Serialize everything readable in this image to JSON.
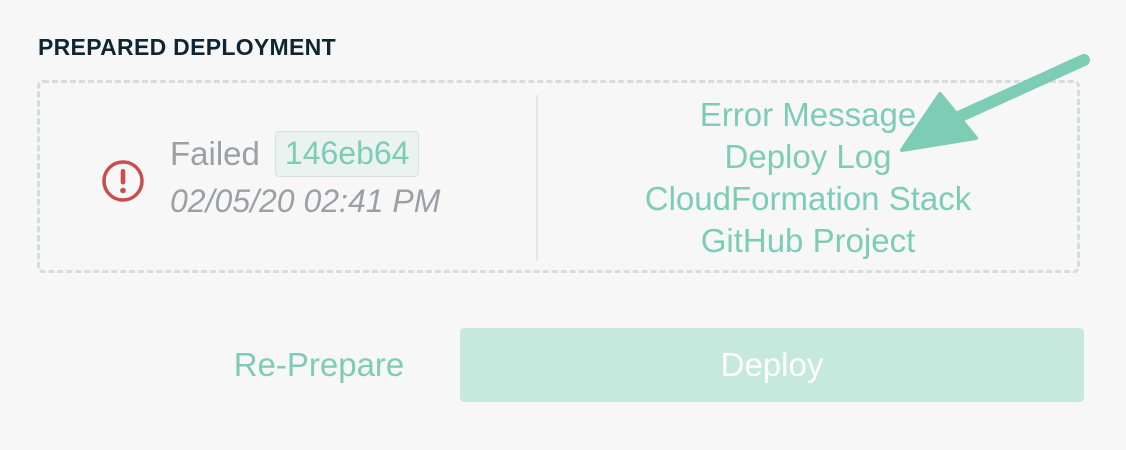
{
  "section": {
    "title": "PREPARED DEPLOYMENT"
  },
  "deployment": {
    "status": "Failed",
    "commit": "146eb64",
    "timestamp": "02/05/20 02:41 PM",
    "status_icon": "error-exclamation-icon"
  },
  "links": [
    {
      "label": "Error Message"
    },
    {
      "label": "Deploy Log"
    },
    {
      "label": "CloudFormation Stack"
    },
    {
      "label": "GitHub Project"
    }
  ],
  "annotation": {
    "icon": "arrow-pointer-icon",
    "color": "#7dcdb5"
  },
  "actions": {
    "reprepare_label": "Re-Prepare",
    "deploy_label": "Deploy"
  },
  "colors": {
    "accent": "#7dcdb5",
    "error": "#cc4b4b",
    "title": "#0f2533",
    "muted_text": "#9aa1a6",
    "deploy_disabled_bg": "#c7e8dd"
  }
}
